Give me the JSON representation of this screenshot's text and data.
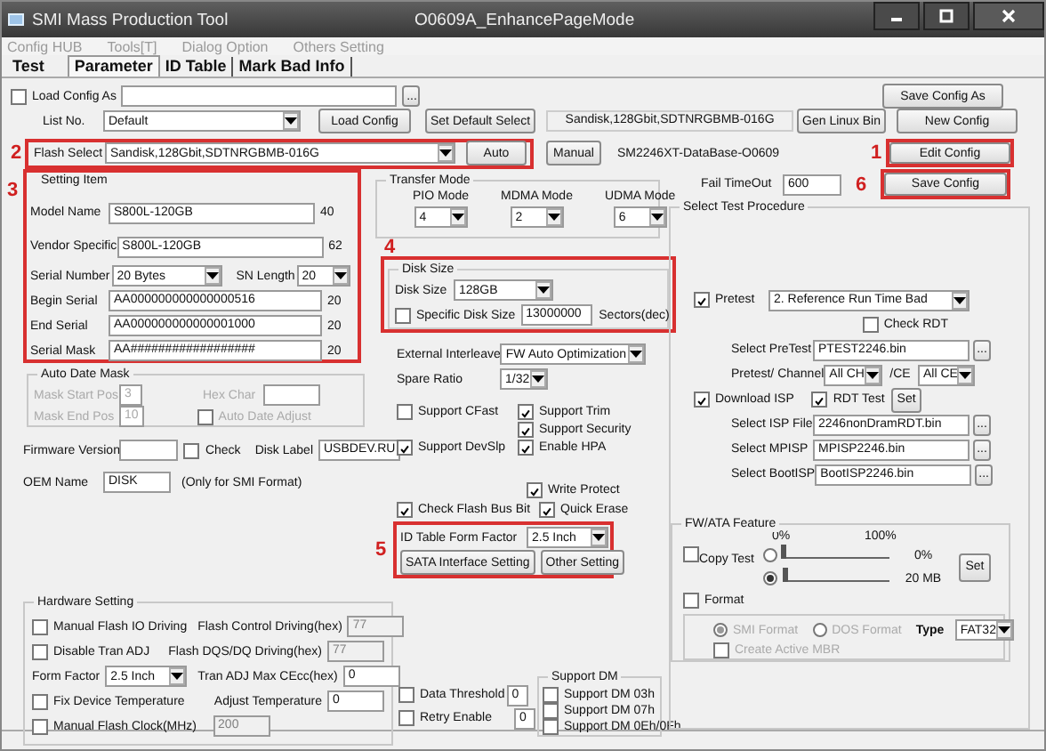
{
  "window": {
    "title": "SMI Mass Production Tool",
    "subtitle": "O0609A_EnhancePageMode"
  },
  "menu": [
    {
      "label": "Config HUB"
    },
    {
      "label": "Tools[T]"
    },
    {
      "label": "Dialog Option"
    },
    {
      "label": "Others Setting"
    }
  ],
  "tabs": [
    {
      "label": "Test",
      "selected": false
    },
    {
      "label": "Parameter",
      "selected": true
    },
    {
      "label": "ID Table",
      "selected": false
    },
    {
      "label": "Mark Bad Info",
      "selected": false
    }
  ],
  "load_config_as": {
    "label": "Load Config As",
    "checked": false,
    "browse": "..."
  },
  "save_config_as": "Save Config As",
  "list_no": {
    "label": "List No.",
    "value": "Default"
  },
  "load_config": "Load Config",
  "set_default_select": "Set Default Select",
  "flash_id": {
    "value": "Sandisk,128Gbit,SDTNRGBMB-016G"
  },
  "gen_linux_bin": "Gen Linux Bin",
  "new_config": "New Config",
  "flash_select": {
    "marker": "2",
    "label": "Flash Select",
    "value": "Sandisk,128Gbit,SDTNRGBMB-016G",
    "auto": "Auto"
  },
  "manual": "Manual",
  "database": "SM2246XT-DataBase-O0609",
  "edit_config": {
    "marker": "1",
    "label": "Edit Config"
  },
  "fail_timeout": {
    "label": "Fail TimeOut",
    "value": "600"
  },
  "save_config": {
    "marker": "6",
    "label": "Save Config"
  },
  "setting_item": {
    "marker": "3",
    "title": "Setting Item",
    "model_name": {
      "label": "Model Name",
      "value": "S800L-120GB",
      "limit": "40"
    },
    "vendor_specific": {
      "label": "Vendor Specific",
      "value": "S800L-120GB",
      "limit": "62"
    },
    "serial_number": {
      "label": "Serial Number",
      "value": "20 Bytes"
    },
    "sn_length": {
      "label": "SN Length",
      "value": "20"
    },
    "begin_serial": {
      "label": "Begin Serial",
      "value": "AA000000000000000516",
      "limit": "20"
    },
    "end_serial": {
      "label": "End Serial",
      "value": "AA000000000000001000",
      "limit": "20"
    },
    "serial_mask": {
      "label": "Serial Mask",
      "value": "AA##################",
      "limit": "20"
    }
  },
  "auto_date_mask": {
    "title": "Auto Date Mask",
    "disabled": true,
    "mask_start_pos": {
      "label": "Mask Start Pos",
      "value": "3"
    },
    "mask_end_pos": {
      "label": "Mask End Pos",
      "value": "10"
    },
    "hex_char": {
      "label": "Hex Char"
    },
    "auto_date_adjust": {
      "label": "Auto Date Adjust",
      "checked": false
    }
  },
  "firmware_version": {
    "label": "Firmware Version"
  },
  "check": {
    "label": "Check",
    "checked": false
  },
  "disk_label": {
    "label": "Disk Label",
    "value": "USBDEV.RU"
  },
  "oem_name": {
    "label": "OEM Name",
    "value": "DISK",
    "note": "(Only for SMI Format)"
  },
  "transfer_mode": {
    "title": "Transfer Mode",
    "modes": [
      {
        "label": "PIO Mode",
        "value": "4"
      },
      {
        "label": "MDMA Mode",
        "value": "2"
      },
      {
        "label": "UDMA Mode",
        "value": "6"
      }
    ]
  },
  "disk_size": {
    "marker": "4",
    "title": "Disk Size",
    "size": {
      "label": "Disk Size",
      "value": "128GB"
    },
    "specific": {
      "label": "Specific Disk Size",
      "checked": false,
      "value": "13000000",
      "unit": "Sectors(dec)"
    }
  },
  "external_interleave": {
    "label": "External Interleave",
    "value": "FW Auto Optimization"
  },
  "spare_ratio": {
    "label": "Spare Ratio",
    "value": "1/32"
  },
  "support": [
    {
      "label": "Support CFast",
      "checked": false
    },
    {
      "label": "Support Trim",
      "checked": true
    },
    {
      "label": "Support Security",
      "checked": true
    },
    {
      "label": "Support DevSlp",
      "checked": true
    },
    {
      "label": "Enable HPA",
      "checked": true
    }
  ],
  "write_protect": {
    "label": "Write Protect",
    "checked": true
  },
  "check_flash_bus_bit": {
    "label": "Check Flash Bus Bit",
    "checked": true
  },
  "quick_erase": {
    "label": "Quick Erase",
    "checked": true
  },
  "id_table": {
    "marker": "5",
    "form_factor": {
      "label": "ID Table Form Factor",
      "value": "2.5 Inch"
    },
    "sata_interface_setting": "SATA Interface Setting",
    "other_setting": "Other Setting"
  },
  "hardware_setting": {
    "title": "Hardware Setting",
    "manual_flash_io_driving": {
      "label": "Manual Flash IO Driving",
      "checked": false
    },
    "flash_control_driving": {
      "label": "Flash Control Driving(hex)",
      "value": "77",
      "disabled": true
    },
    "disable_tran_adj": {
      "label": "Disable Tran ADJ",
      "checked": false
    },
    "flash_dqs_dq_driving": {
      "label": "Flash DQS/DQ Driving(hex)",
      "value": "77",
      "disabled": true
    },
    "form_factor": {
      "label": "Form Factor",
      "value": "2.5 Inch"
    },
    "tran_adj_max_cecc": {
      "label": "Tran ADJ Max CEcc(hex)",
      "value": "0"
    },
    "fix_device_temperature": {
      "label": "Fix Device Temperature",
      "checked": false
    },
    "adjust_temperature": {
      "label": "Adjust Temperature",
      "value": "0"
    },
    "manual_flash_clock": {
      "label": "Manual Flash Clock(MHz)",
      "checked": false
    },
    "flash_clock": {
      "value": "200",
      "disabled": true
    }
  },
  "data_threshold": {
    "label": "Data Threshold",
    "checked": false,
    "value": "0"
  },
  "retry_enable": {
    "label": "Retry Enable",
    "checked": false,
    "value": "0"
  },
  "support_dm": {
    "title": "Support DM",
    "items": [
      {
        "label": "Support DM 03h",
        "checked": false
      },
      {
        "label": "Support DM 07h",
        "checked": false
      },
      {
        "label": "Support DM 0Eh/0Fh",
        "checked": false
      }
    ]
  },
  "test_procedure": {
    "title": "Select Test Procedure",
    "pretest": {
      "label": "Pretest",
      "checked": true,
      "value": "2. Reference Run Time Bad"
    },
    "check_rdt": {
      "label": "Check RDT",
      "checked": false
    },
    "select_pretest": {
      "label": "Select PreTest",
      "value": "PTEST2246.bin",
      "browse": "..."
    },
    "channel": {
      "label": "Pretest/ Channel",
      "value": "All CH"
    },
    "ce": {
      "label": "/CE",
      "value": "All CE"
    },
    "download_isp": {
      "label": "Download ISP",
      "checked": true
    },
    "rdt_test": {
      "label": "RDT Test",
      "checked": true,
      "set": "Set"
    },
    "files": [
      {
        "label": "Select ISP File",
        "value": "2246nonDramRDT.bin",
        "browse": "..."
      },
      {
        "label": "Select MPISP",
        "value": "MPISP2246.bin",
        "browse": "..."
      },
      {
        "label": "Select BootISP",
        "value": "BootISP2246.bin",
        "browse": "..."
      }
    ]
  },
  "fw_ata_feature": {
    "title": "FW/ATA Feature",
    "scale_min": "0%",
    "scale_max": "100%",
    "copy_test": {
      "label": "Copy Test",
      "checked": false
    },
    "sliders": [
      {
        "selected": false,
        "level": 0,
        "reading": "0%"
      },
      {
        "selected": true,
        "level": 0.02,
        "reading": "20 MB"
      }
    ],
    "set": "Set",
    "format": {
      "label": "Format",
      "checked": false
    },
    "format_options": {
      "disabled": true,
      "modes": [
        {
          "label": "SMI Format",
          "selected": true
        },
        {
          "label": "DOS Format",
          "selected": false
        }
      ],
      "type": {
        "label": "Type",
        "value": "FAT32"
      },
      "create_active_mbr": {
        "label": "Create Active MBR",
        "checked": false
      }
    }
  }
}
